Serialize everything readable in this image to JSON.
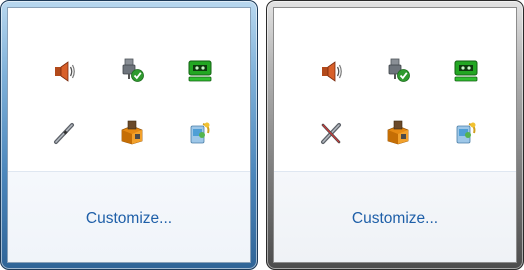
{
  "flyouts": [
    {
      "theme": "blue",
      "icons": [
        "speaker-icon",
        "usb-safe-remove-icon",
        "network-adapter-icon",
        "pen-tablet-icon",
        "software-box-icon",
        "phone-card-icon"
      ],
      "customize_label": "Customize..."
    },
    {
      "theme": "gray",
      "icons": [
        "speaker-icon",
        "usb-safe-remove-icon",
        "network-adapter-icon",
        "pen-tablet-disabled-icon",
        "software-box-icon",
        "phone-card-icon"
      ],
      "customize_label": "Customize..."
    }
  ],
  "colors": {
    "link": "#1e5fa8",
    "blue_frame": "#4b86bb",
    "gray_frame": "#7f7f7f"
  }
}
